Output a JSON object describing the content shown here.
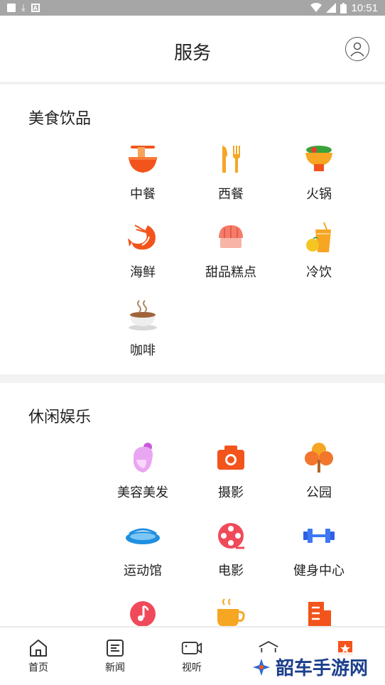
{
  "status_bar": {
    "time": "10:51"
  },
  "header": {
    "title": "服务"
  },
  "food_section": {
    "title": "美食饮品",
    "items": [
      {
        "label": "中餐"
      },
      {
        "label": "西餐"
      },
      {
        "label": "火锅"
      },
      {
        "label": "海鲜"
      },
      {
        "label": "甜品糕点"
      },
      {
        "label": "冷饮"
      },
      {
        "label": "咖啡"
      }
    ]
  },
  "leisure_section": {
    "title": "休闲娱乐",
    "items": [
      {
        "label": "美容美发"
      },
      {
        "label": "摄影"
      },
      {
        "label": "公园"
      },
      {
        "label": "运动馆"
      },
      {
        "label": "电影"
      },
      {
        "label": "健身中心"
      }
    ]
  },
  "tabbar": {
    "tabs": [
      {
        "label": "首页"
      },
      {
        "label": "新闻"
      },
      {
        "label": "视听"
      }
    ]
  },
  "watermark": {
    "text": "韶车手游网"
  },
  "colors": {
    "accent": "#f2541b",
    "status_bar": "#a6a6a6"
  }
}
